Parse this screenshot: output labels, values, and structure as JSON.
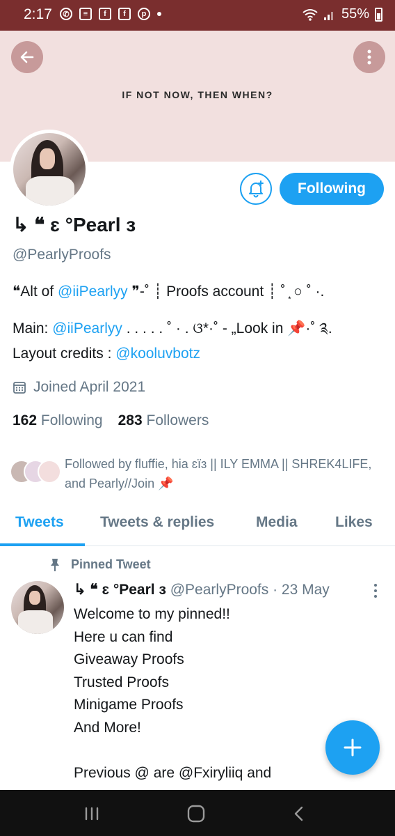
{
  "status_bar": {
    "time": "2:17",
    "left_icons": [
      "whatsapp-icon",
      "message-icon",
      "facebook-icon",
      "facebook-icon",
      "pinterest-icon",
      "dot-icon"
    ],
    "battery": "55%"
  },
  "banner": {
    "text": "IF NOT NOW, THEN WHEN?",
    "color": "#f2e0df"
  },
  "profile": {
    "display_name": "↳ ❝ ɛ °Pearl ɜ",
    "handle": "@PearlyProofs",
    "bio": {
      "line1_prefix": "❝Alt of ",
      "line1_link": "@iiPearlyy",
      "line1_suffix": " ❞-˚ ┊ Proofs account ┊ ˚ ͙ ○ ˚ ·.",
      "line2_prefix": "Main: ",
      "line2_link": "@iiPearlyy",
      "line2_suffix": " . . . . . ˚ · .  ଓ*·˚ - „Look in 📌·˚ ༉.",
      "line3_prefix": "Layout credits :  ",
      "line3_link": "@kooluvbotz"
    },
    "joined": "Joined April 2021",
    "following_count": "162",
    "following_label": "Following",
    "followers_count": "283",
    "followers_label": "Followers",
    "followed_by": "Followed by fluffie, hia ɛïɜ || ILY EMMA || SHREK4LIFE, and Pearly//Join 📌"
  },
  "actions": {
    "following_label": "Following"
  },
  "tabs": [
    {
      "label": "Tweets",
      "active": true
    },
    {
      "label": "Tweets & replies",
      "active": false
    },
    {
      "label": "Media",
      "active": false
    },
    {
      "label": "Likes",
      "active": false
    }
  ],
  "pinned_tweet": {
    "pinned_label": "Pinned Tweet",
    "author_name": "↳ ❝ ɛ °Pearl ɜ",
    "author_meta": " @PearlyProofs · 23 May",
    "text": "Welcome to my pinned!!\nHere u can find\nGiveaway Proofs\nTrusted Proofs\nMinigame Proofs\nAnd More!\n\nPrevious @ are @Fxiryliiq and"
  },
  "colors": {
    "accent": "#1da1f2",
    "status_bar": "#7a2e2e",
    "secondary_text": "#657786"
  }
}
